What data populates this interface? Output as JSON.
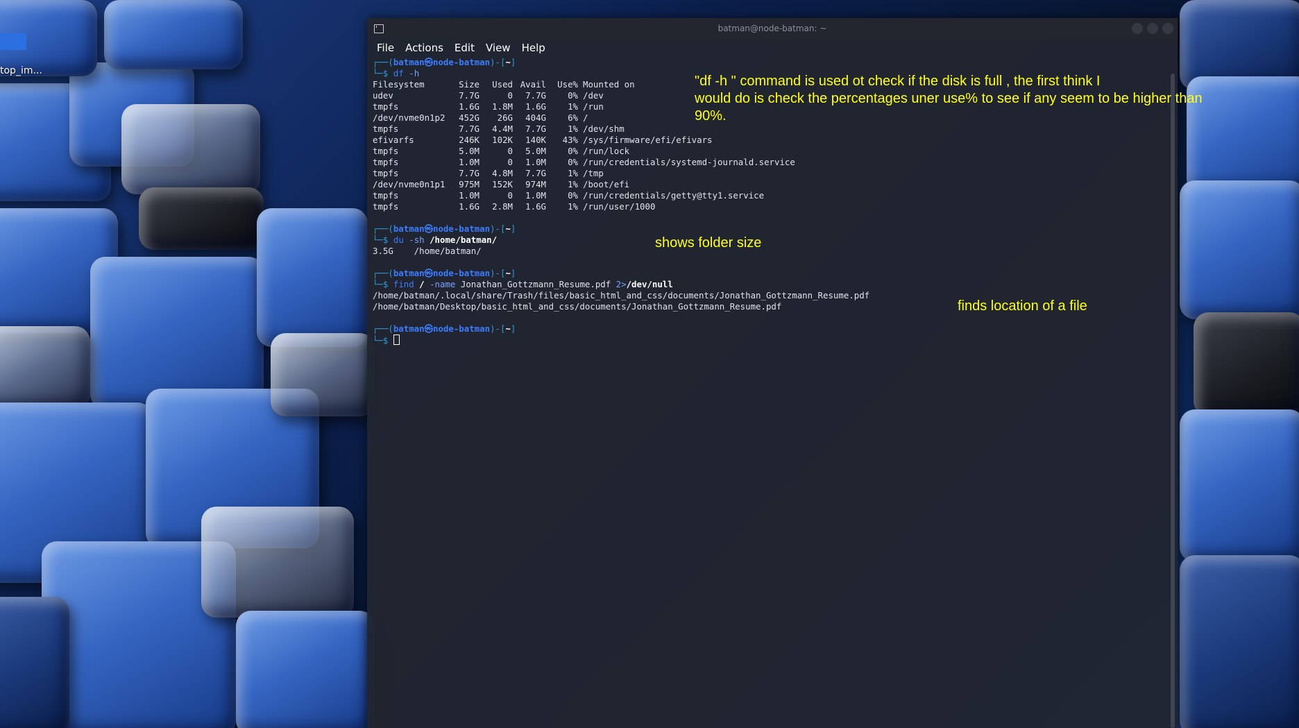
{
  "desktop": {
    "icon_label": "top_im..."
  },
  "window": {
    "title": "batman@node-batman: ~",
    "menu": [
      "File",
      "Actions",
      "Edit",
      "View",
      "Help"
    ]
  },
  "prompt": {
    "open": "┌──(",
    "user": "batman㉿node-batman",
    "mid": ")-[",
    "path": "~",
    "close": "]",
    "arrow": "└─$"
  },
  "commands": {
    "df": {
      "cmd": "df",
      "args": " -h"
    },
    "du": {
      "cmd": "du",
      "args": " -sh ",
      "path": "/home/batman/"
    },
    "find": {
      "cmd": "find",
      "root": " / ",
      "flag": "-name",
      "file": " Jonathan_Gottzmann_Resume.pdf ",
      "redir": "2>",
      "target": "/dev/null"
    }
  },
  "df_output": {
    "header": [
      "Filesystem",
      "Size",
      "Used",
      "Avail",
      "Use%",
      "Mounted on"
    ],
    "rows": [
      [
        "udev",
        "7.7G",
        "0",
        "7.7G",
        "0%",
        "/dev"
      ],
      [
        "tmpfs",
        "1.6G",
        "1.8M",
        "1.6G",
        "1%",
        "/run"
      ],
      [
        "/dev/nvme0n1p2",
        "452G",
        "26G",
        "404G",
        "6%",
        "/"
      ],
      [
        "tmpfs",
        "7.7G",
        "4.4M",
        "7.7G",
        "1%",
        "/dev/shm"
      ],
      [
        "efivarfs",
        "246K",
        "102K",
        "140K",
        "43%",
        "/sys/firmware/efi/efivars"
      ],
      [
        "tmpfs",
        "5.0M",
        "0",
        "5.0M",
        "0%",
        "/run/lock"
      ],
      [
        "tmpfs",
        "1.0M",
        "0",
        "1.0M",
        "0%",
        "/run/credentials/systemd-journald.service"
      ],
      [
        "tmpfs",
        "7.7G",
        "4.8M",
        "7.7G",
        "1%",
        "/tmp"
      ],
      [
        "/dev/nvme0n1p1",
        "975M",
        "152K",
        "974M",
        "1%",
        "/boot/efi"
      ],
      [
        "tmpfs",
        "1.0M",
        "0",
        "1.0M",
        "0%",
        "/run/credentials/getty@tty1.service"
      ],
      [
        "tmpfs",
        "1.6G",
        "2.8M",
        "1.6G",
        "1%",
        "/run/user/1000"
      ]
    ]
  },
  "du_output": "3.5G    /home/batman/",
  "find_output": [
    "/home/batman/.local/share/Trash/files/basic_html_and_css/documents/Jonathan_Gottzmann_Resume.pdf",
    "/home/batman/Desktop/basic_html_and_css/documents/Jonathan_Gottzmann_Resume.pdf"
  ],
  "annotations": {
    "df_note_1": "\"df -h \" command is used ot check if the disk is full , the first think I",
    "df_note_2": "would do is check the percentages uner use% to see if any seem to be higher than",
    "df_note_3": "90%.",
    "du_note": "shows folder size",
    "find_note": "finds location of a file"
  },
  "colors": {
    "terminal_bg": "#212530",
    "prompt_blue": "#3d7bff",
    "annotation_yellow": "#ffff1a"
  }
}
